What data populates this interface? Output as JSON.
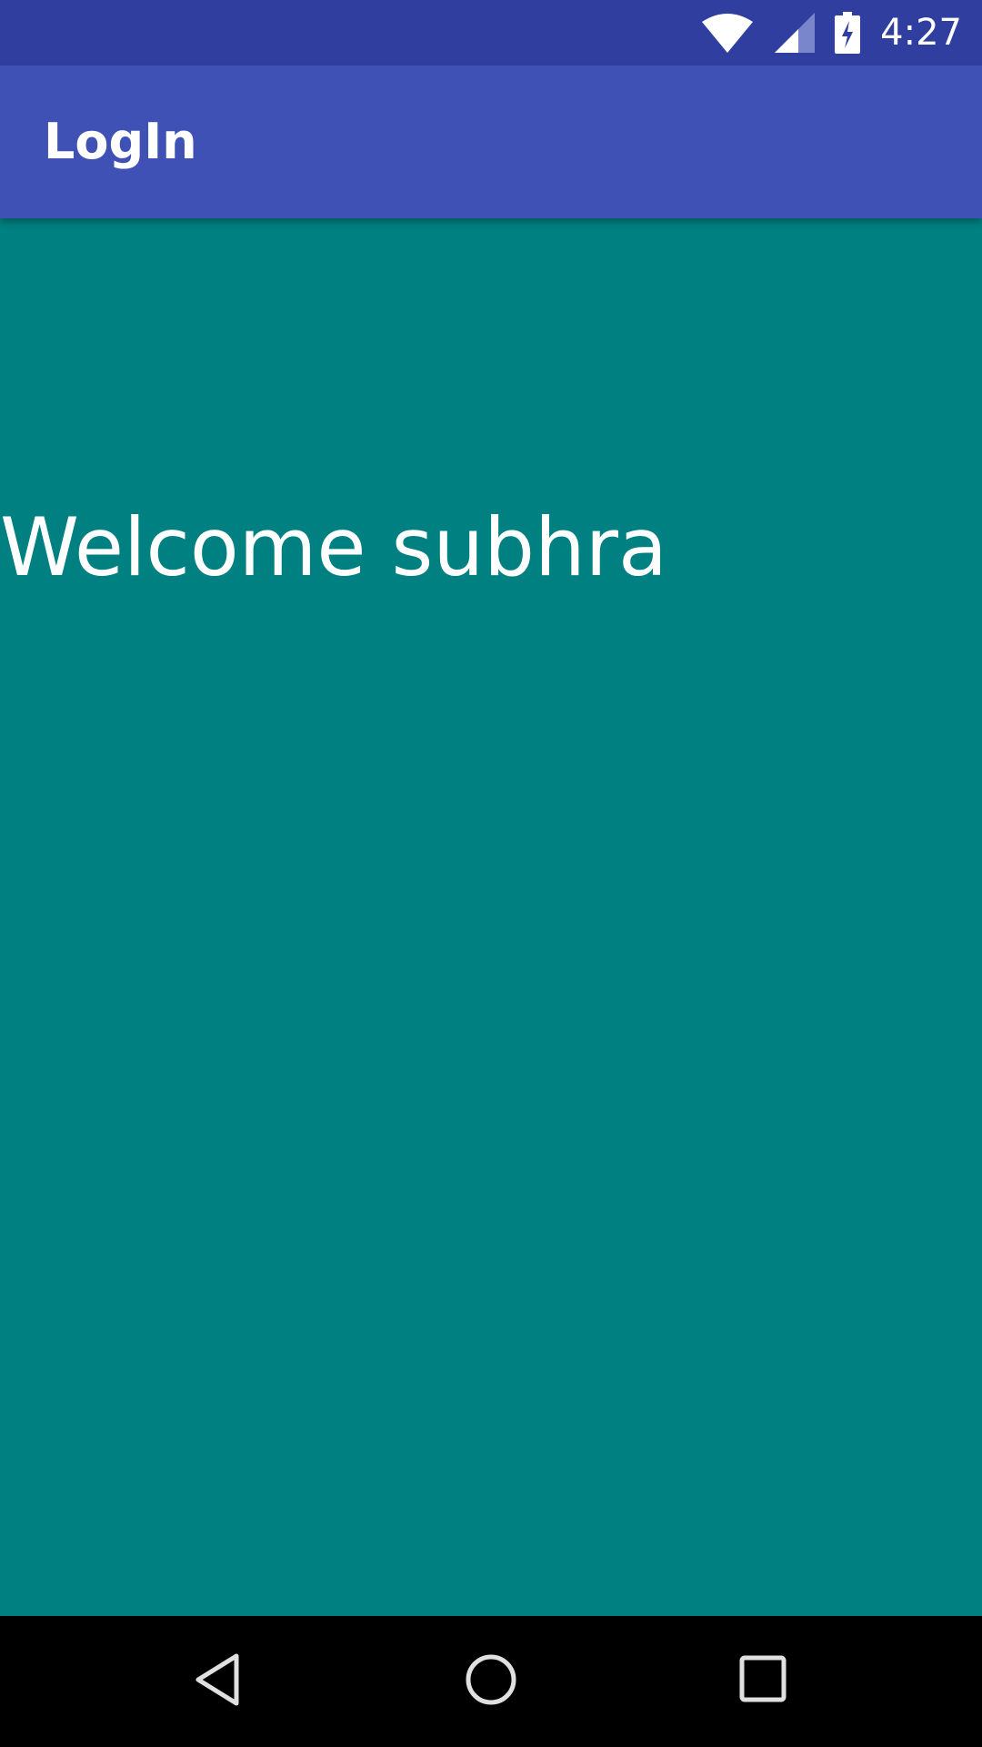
{
  "status_bar": {
    "time": "4:27",
    "icons": [
      "wifi-icon",
      "cell-signal-icon",
      "battery-charging-icon"
    ]
  },
  "app_bar": {
    "title": "LogIn"
  },
  "main": {
    "welcome_text": "Welcome subhra"
  },
  "nav_bar": {
    "buttons": [
      "back-icon",
      "home-icon",
      "recents-icon"
    ]
  },
  "colors": {
    "status_bar": "#303f9f",
    "app_bar": "#3f51b5",
    "background": "#008080",
    "nav_bar": "#000000",
    "text": "#ffffff"
  }
}
